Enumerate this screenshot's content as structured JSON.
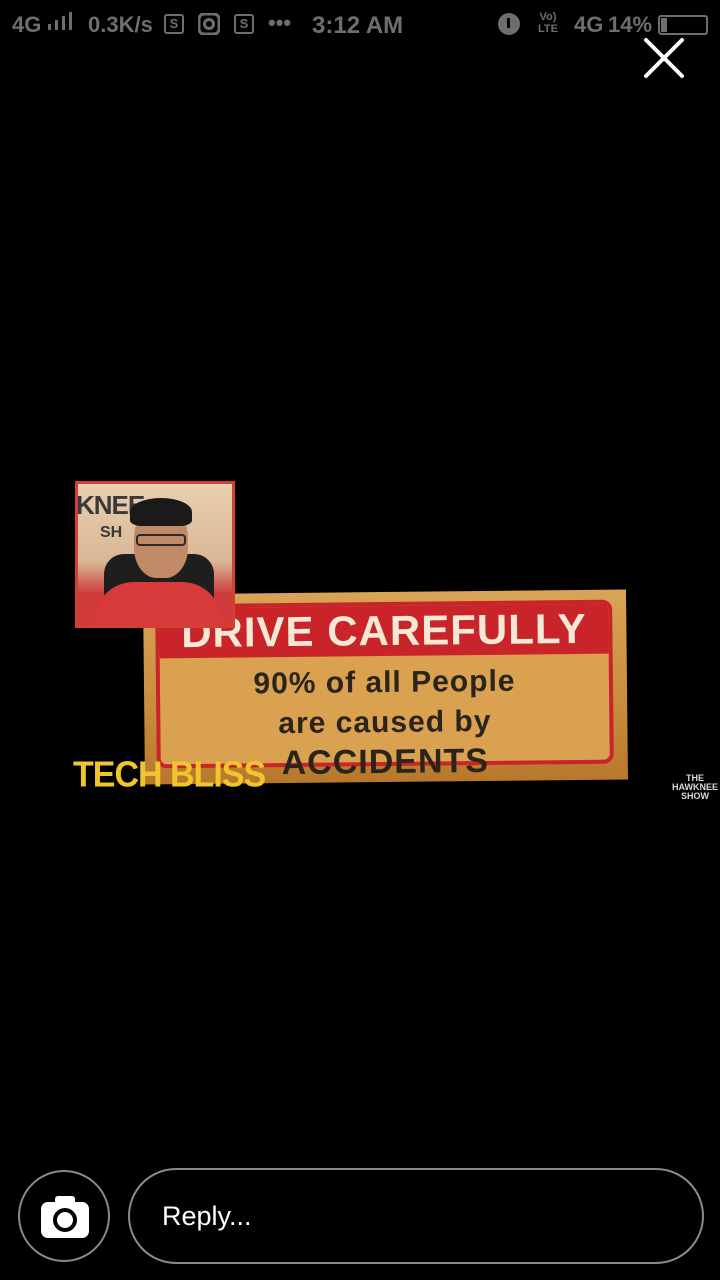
{
  "status_bar": {
    "network": "4G",
    "speed": "0.3K/s",
    "notif_icon_1": "S",
    "notif_icon_2": "S",
    "more": "•••",
    "time": "3:12 AM",
    "volte": "Vo)\nLTE",
    "network2": "4G",
    "battery_percent": "14%",
    "battery_level": 0.14
  },
  "story": {
    "close_icon": "close-icon",
    "sign_header": "DRIVE CAREFULLY",
    "sign_line1": "90% of all People",
    "sign_line2": "are caused by",
    "sign_line3": "ACCIDENTS",
    "cam_wall_text": "KNEE",
    "cam_wall_text2": "SH",
    "brand": "TECH BLISS",
    "watermark": "THE\nHAWKNEE\nSHOW"
  },
  "reply_bar": {
    "camera_icon": "camera-icon",
    "placeholder": "Reply..."
  },
  "colors": {
    "background": "#000000",
    "status_text": "#6e6e6e",
    "sign_red": "#c8242a",
    "brand_yellow": "#f0c62e",
    "outline": "#8a8a8a"
  }
}
